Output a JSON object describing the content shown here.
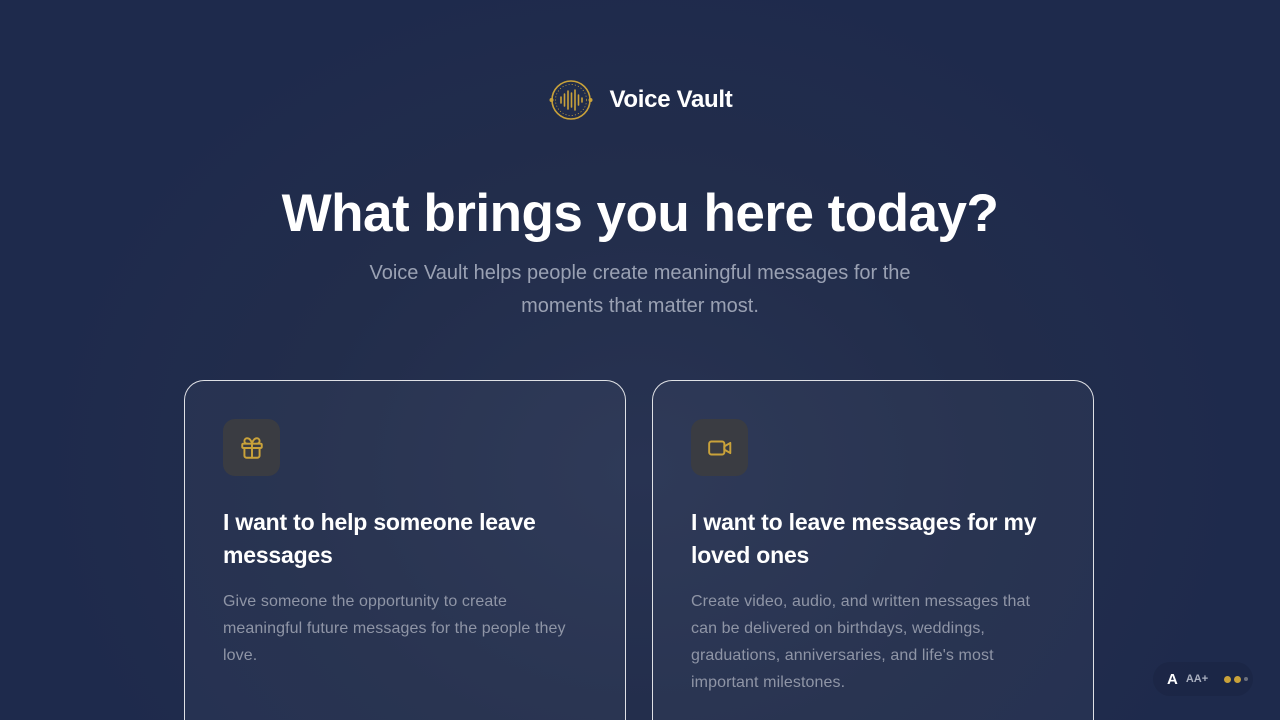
{
  "brand": {
    "name": "Voice Vault",
    "logo_icon": "soundwave-circle-icon",
    "accent_color": "#c9a23a"
  },
  "hero": {
    "headline": "What brings you here today?",
    "subtitle": "Voice Vault helps people create meaningful messages for the moments that matter most."
  },
  "options": [
    {
      "icon": "gift-icon",
      "title": "I want to help someone leave messages",
      "description": "Give someone the opportunity to create meaningful future messages for the people they love."
    },
    {
      "icon": "video-camera-icon",
      "title": "I want to leave messages for my loved ones",
      "description": "Create video, audio, and written messages that can be delivered on birthdays, weddings, graduations, anniversaries, and life's most important milestones."
    }
  ],
  "accessibility": {
    "font_default": "A",
    "font_larger": "AA+",
    "theme_toggle_icon": "contrast-dots-icon"
  },
  "colors": {
    "background": "#1e2a4c",
    "card_border": "#ffffff",
    "muted_text": "#9aa1b3",
    "icon_accent": "#c9a23a"
  }
}
